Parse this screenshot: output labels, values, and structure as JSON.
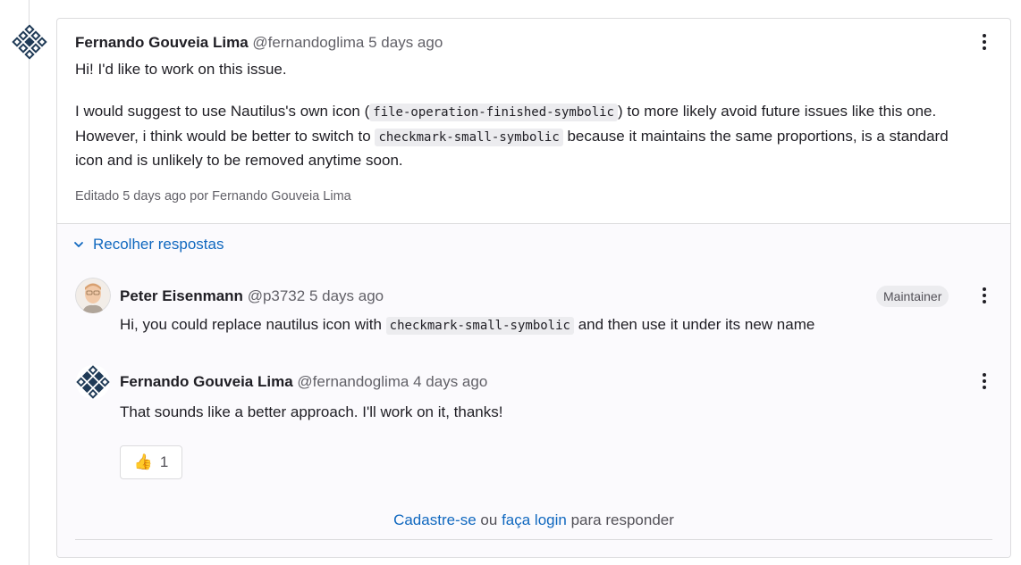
{
  "main_note": {
    "author": "Fernando Gouveia Lima",
    "handle": "@fernandoglima",
    "time": "5 days ago",
    "paragraph1": "Hi! I'd like to work on this issue.",
    "p2_text1": "I would suggest to use Nautilus's own icon (",
    "p2_code1": "file-operation-finished-symbolic",
    "p2_text2": ") to more likely avoid future issues like this one. However, i think would be better to switch to ",
    "p2_code2": "checkmark-small-symbolic",
    "p2_text3": " because it maintains the same proportions, is a standard icon and is unlikely to be removed anytime soon.",
    "edited": "Editado 5 days ago por Fernando Gouveia Lima"
  },
  "replies_toggle": "Recolher respostas",
  "reply1": {
    "author": "Peter Eisenmann",
    "handle": "@p3732",
    "time": "5 days ago",
    "badge": "Maintainer",
    "text1": "Hi, you could replace nautilus icon with ",
    "code": "checkmark-small-symbolic",
    "text2": " and then use it under its new name"
  },
  "reply2": {
    "author": "Fernando Gouveia Lima",
    "handle": "@fernandoglima",
    "time": "4 days ago",
    "text": "That sounds like a better approach. I'll work on it, thanks!",
    "reaction_emoji": "👍",
    "reaction_count": "1"
  },
  "footer": {
    "signup": "Cadastre-se",
    "or": "ou",
    "login": "faça login",
    "suffix": "para responder"
  },
  "colors": {
    "link": "#1068bf",
    "muted": "#626168",
    "border": "#dcdcde"
  },
  "icons": [
    "kebab-menu-icon",
    "chevron-down-icon",
    "thumbs-up-icon"
  ]
}
